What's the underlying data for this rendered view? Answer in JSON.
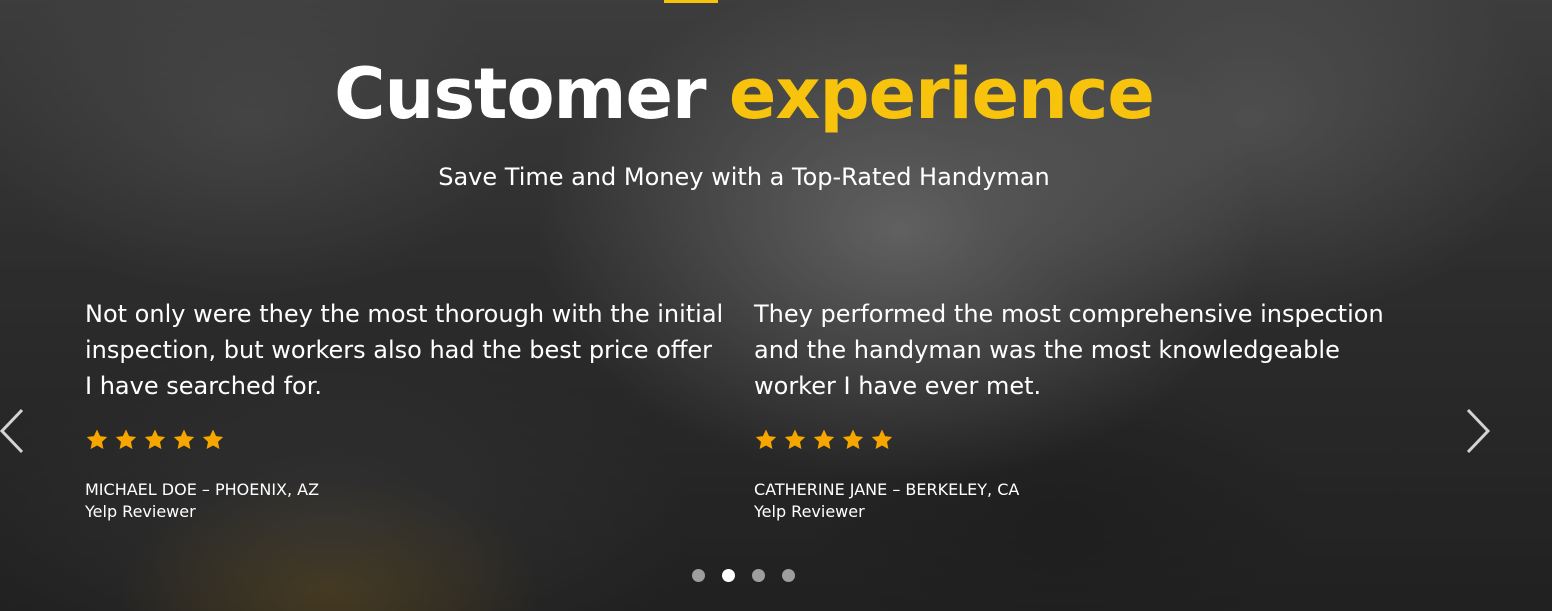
{
  "section": {
    "title_part1": "Customer",
    "title_part2": "experience",
    "subtitle": "Save Time and Money with a Top-Rated Handyman"
  },
  "colors": {
    "accent": "#f7c30c",
    "text": "#ffffff",
    "star": "#f7a600"
  },
  "testimonials": [
    {
      "quote": "Not only were they the most thorough with the initial inspection, but workers also had the best price offer I have searched for.",
      "rating": 5,
      "author": "MICHAEL DOE – PHOENIX, AZ",
      "role": "Yelp Reviewer"
    },
    {
      "quote": "They performed the most comprehensive inspection and the handyman was the most knowledgeable worker I have ever met.",
      "rating": 5,
      "author": "CATHERINE JANE – BERKELEY, CA",
      "role": "Yelp Reviewer"
    }
  ],
  "carousel": {
    "prev_icon": "chevron-left-icon",
    "next_icon": "chevron-right-icon",
    "page_count": 4,
    "active_page": 2
  }
}
